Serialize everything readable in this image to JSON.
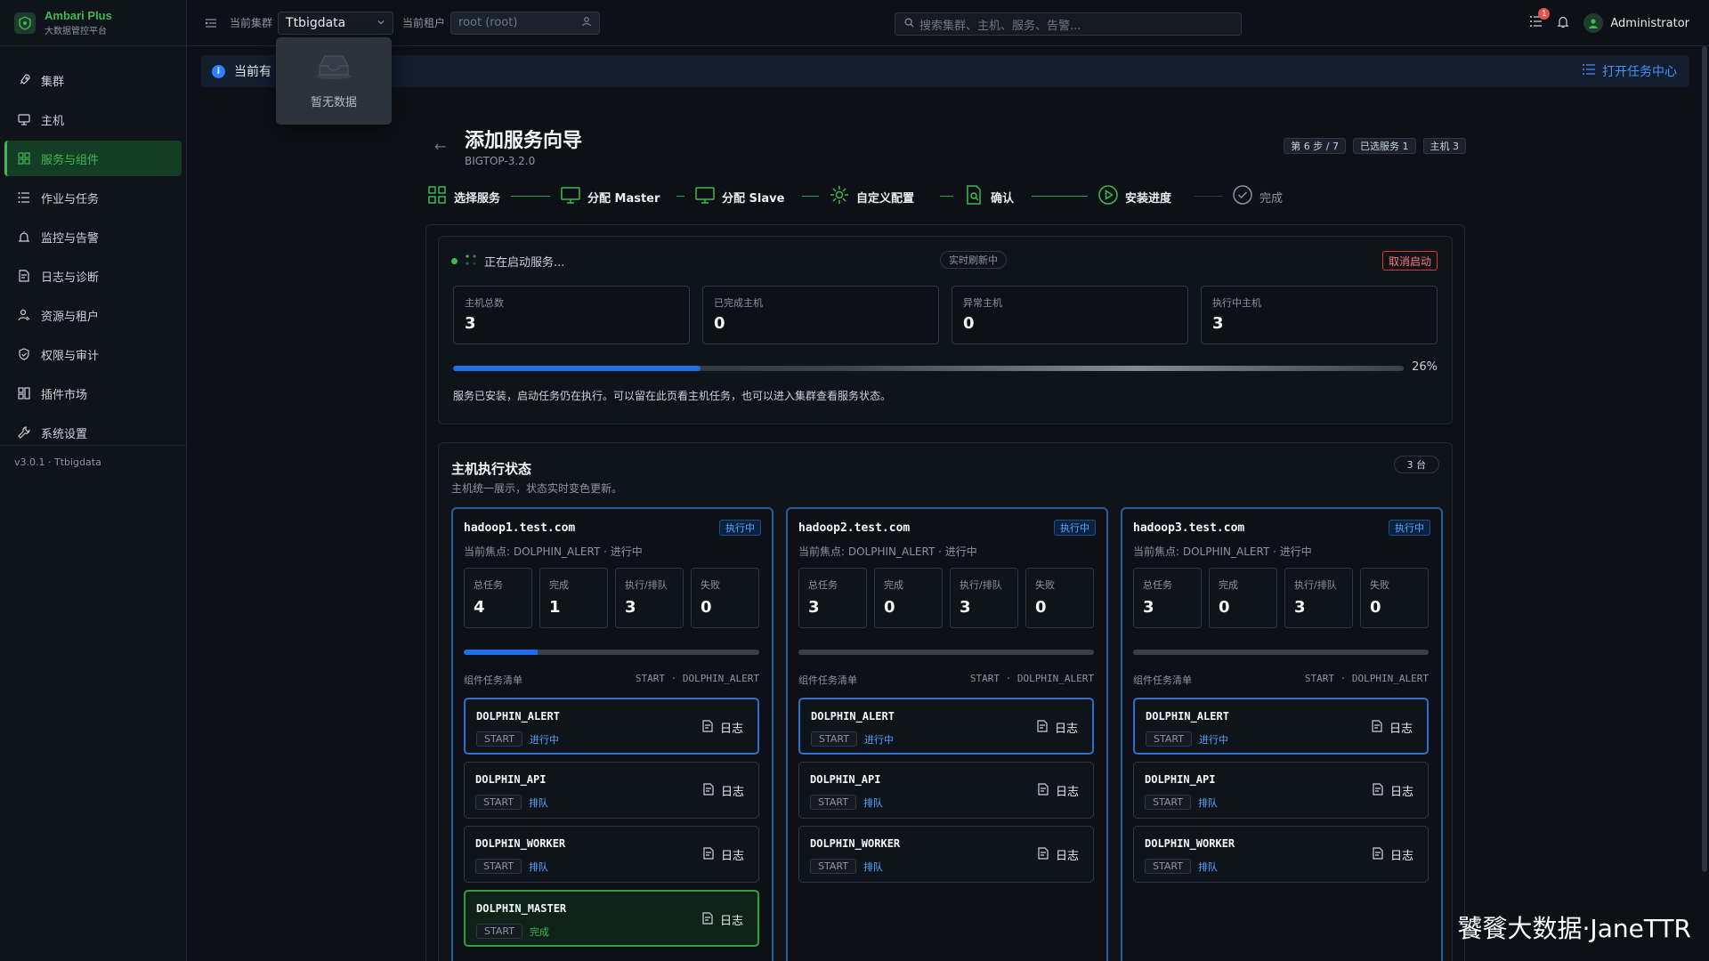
{
  "brand": {
    "name": "Ambari Plus",
    "subtitle": "大数据管控平台"
  },
  "sidebar": {
    "items": [
      {
        "label": "集群",
        "icon": "rocket-icon"
      },
      {
        "label": "主机",
        "icon": "monitor-icon"
      },
      {
        "label": "服务与组件",
        "icon": "grid-icon",
        "active": true
      },
      {
        "label": "作业与任务",
        "icon": "list-icon"
      },
      {
        "label": "监控与告警",
        "icon": "alarm-icon"
      },
      {
        "label": "日志与诊断",
        "icon": "log-icon"
      },
      {
        "label": "资源与租户",
        "icon": "user-icon"
      },
      {
        "label": "权限与审计",
        "icon": "shield-icon"
      },
      {
        "label": "插件市场",
        "icon": "plugin-icon"
      },
      {
        "label": "系统设置",
        "icon": "wrench-icon"
      }
    ],
    "version": "v3.0.1 · Ttbigdata"
  },
  "topbar": {
    "cluster_label": "当前集群",
    "cluster_value": "Ttbigdata",
    "tenant_label": "当前租户",
    "tenant_placeholder": "root (root)",
    "search_placeholder": "搜索集群、主机、服务、告警...",
    "notification_count": "1",
    "user": "Administrator"
  },
  "dropdown": {
    "empty_text": "暂无数据"
  },
  "banner": {
    "text": "当前有 1",
    "link": "打开任务中心"
  },
  "header": {
    "title": "添加服务向导",
    "subtitle": "BIGTOP-3.2.0",
    "chips": [
      "第 6 步 / 7",
      "已选服务 1",
      "主机 3"
    ]
  },
  "steps": [
    {
      "label": "选择服务"
    },
    {
      "label": "分配 Master"
    },
    {
      "label": "分配 Slave"
    },
    {
      "label": "自定义配置"
    },
    {
      "label": "确认"
    },
    {
      "label": "安装进度"
    },
    {
      "label": "完成"
    }
  ],
  "progress_card": {
    "status": "正在启动服务...",
    "live": "实时刷新中",
    "cancel": "取消启动",
    "stats": [
      {
        "label": "主机总数",
        "value": "3"
      },
      {
        "label": "已完成主机",
        "value": "0"
      },
      {
        "label": "异常主机",
        "value": "0"
      },
      {
        "label": "执行中主机",
        "value": "3"
      }
    ],
    "progress": 26,
    "progress_text": "26%",
    "description": "服务已安装，启动任务仍在执行。可以留在此页看主机任务，也可以进入集群查看服务状态。"
  },
  "hosts_card": {
    "title": "主机执行状态",
    "subtitle": "主机统一展示，状态实时变色更新。",
    "count": "3 台",
    "stat_labels": [
      "总任务",
      "完成",
      "执行/排队",
      "失败"
    ],
    "component_list_label": "组件任务清单",
    "log_label": "日志",
    "hosts": [
      {
        "name": "hadoop1.test.com",
        "badge": "执行中",
        "focus": "当前焦点: DOLPHIN_ALERT · 进行中",
        "stats": [
          "4",
          "1",
          "3",
          "0"
        ],
        "progress": 25,
        "current": "START · DOLPHIN_ALERT",
        "components": [
          {
            "name": "DOLPHIN_ALERT",
            "op": "START",
            "state": "进行中",
            "kind": "running"
          },
          {
            "name": "DOLPHIN_API",
            "op": "START",
            "state": "排队",
            "kind": "queue"
          },
          {
            "name": "DOLPHIN_WORKER",
            "op": "START",
            "state": "排队",
            "kind": "queue"
          },
          {
            "name": "DOLPHIN_MASTER",
            "op": "START",
            "state": "完成",
            "kind": "done"
          }
        ]
      },
      {
        "name": "hadoop2.test.com",
        "badge": "执行中",
        "focus": "当前焦点: DOLPHIN_ALERT · 进行中",
        "stats": [
          "3",
          "0",
          "3",
          "0"
        ],
        "progress": 0,
        "current": "START · DOLPHIN_ALERT",
        "components": [
          {
            "name": "DOLPHIN_ALERT",
            "op": "START",
            "state": "进行中",
            "kind": "running"
          },
          {
            "name": "DOLPHIN_API",
            "op": "START",
            "state": "排队",
            "kind": "queue"
          },
          {
            "name": "DOLPHIN_WORKER",
            "op": "START",
            "state": "排队",
            "kind": "queue"
          }
        ]
      },
      {
        "name": "hadoop3.test.com",
        "badge": "执行中",
        "focus": "当前焦点: DOLPHIN_ALERT · 进行中",
        "stats": [
          "3",
          "0",
          "3",
          "0"
        ],
        "progress": 0,
        "current": "START · DOLPHIN_ALERT",
        "components": [
          {
            "name": "DOLPHIN_ALERT",
            "op": "START",
            "state": "进行中",
            "kind": "running"
          },
          {
            "name": "DOLPHIN_API",
            "op": "START",
            "state": "排队",
            "kind": "queue"
          },
          {
            "name": "DOLPHIN_WORKER",
            "op": "START",
            "state": "排队",
            "kind": "queue"
          }
        ]
      }
    ]
  },
  "watermark": "饕餮大数据·JaneTTR"
}
